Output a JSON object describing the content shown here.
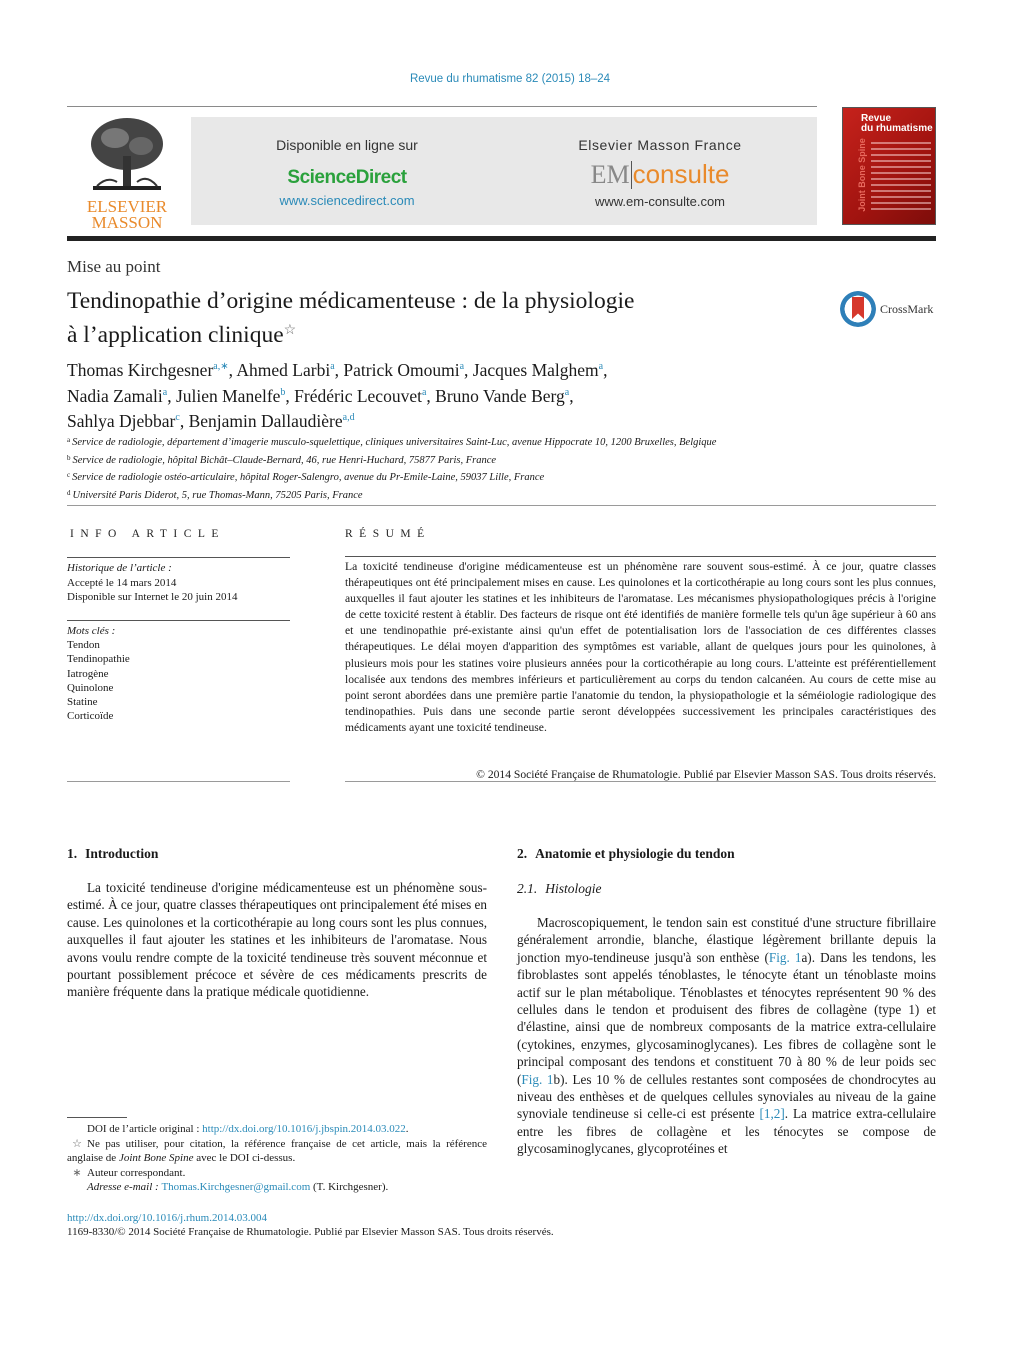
{
  "journal_ref": "Revue du rhumatisme 82 (2015) 18–24",
  "publisher_logo": {
    "icon": "elsevier-tree-logo",
    "line1": "ELSEVIER",
    "line2": "MASSON"
  },
  "banner": {
    "sciencedirect": {
      "caption": "Disponible en ligne sur",
      "name": "ScienceDirect",
      "url": "www.sciencedirect.com"
    },
    "emconsulte": {
      "caption": "Elsevier Masson France",
      "name_em": "EM",
      "name_consulte": "consulte",
      "url": "www.em-consulte.com"
    }
  },
  "cover": {
    "title_line1": "Revue",
    "title_line2": "du rhumatisme",
    "side_text": "Joint Bone Spine"
  },
  "article": {
    "section_type": "Mise au point",
    "title_line1": "Tendinopathie d’origine médicamenteuse : de la physiologie",
    "title_line2": "à l’application clinique",
    "title_mark": "☆",
    "crossmark_label": "CrossMark",
    "authors": [
      {
        "name": "Thomas Kirchgesner",
        "aff": "a,∗",
        "sep": ", "
      },
      {
        "name": "Ahmed Larbi",
        "aff": "a",
        "sep": ", "
      },
      {
        "name": "Patrick Omoumi",
        "aff": "a",
        "sep": ", "
      },
      {
        "name": "Jacques Malghem",
        "aff": "a",
        "sep": ","
      },
      {
        "name": "Nadia Zamali",
        "aff": "a",
        "sep": ", "
      },
      {
        "name": "Julien Manelfe",
        "aff": "b",
        "sep": ", "
      },
      {
        "name": "Frédéric Lecouvet",
        "aff": "a",
        "sep": ", "
      },
      {
        "name": "Bruno Vande Berg",
        "aff": "a",
        "sep": ","
      },
      {
        "name": "Sahlya Djebbar",
        "aff": "c",
        "sep": ", "
      },
      {
        "name": "Benjamin Dallaudière",
        "aff": "a,d",
        "sep": ""
      }
    ],
    "affiliations": [
      {
        "key": "a",
        "text": "Service de radiologie, département d’imagerie musculo-squelettique, cliniques universitaires Saint-Luc, avenue Hippocrate 10, 1200 Bruxelles, Belgique"
      },
      {
        "key": "b",
        "text": "Service de radiologie, hôpital Bichât–Claude-Bernard, 46, rue Henri-Huchard, 75877 Paris, France"
      },
      {
        "key": "c",
        "text": "Service de radiologie ostéo-articulaire, hôpital Roger-Salengro, avenue du Pr-Emile-Laine, 59037 Lille, France"
      },
      {
        "key": "d",
        "text": "Université Paris Diderot, 5, rue Thomas-Mann, 75205 Paris, France"
      }
    ]
  },
  "info": {
    "heading": "INFO ARTICLE",
    "history_label": "Historique de l’article :",
    "history": [
      "Accepté le 14 mars 2014",
      "Disponible sur Internet le 20 juin 2014"
    ],
    "keywords_label": "Mots clés :",
    "keywords": [
      "Tendon",
      "Tendinopathie",
      "Iatrogène",
      "Quinolone",
      "Statine",
      "Corticoïde"
    ]
  },
  "resume": {
    "heading": "RÉSUMÉ",
    "text": "La toxicité tendineuse d'origine médicamenteuse est un phénomène rare souvent sous-estimé. À ce jour, quatre classes thérapeutiques ont été principalement mises en cause. Les quinolones et la corticothérapie au long cours sont les plus connues, auxquelles il faut ajouter les statines et les inhibiteurs de l'aromatase. Les mécanismes physiopathologiques précis à l'origine de cette toxicité restent à établir. Des facteurs de risque ont été identifiés de manière formelle tels qu'un âge supérieur à 60 ans et une tendinopathie pré-existante ainsi qu'un effet de potentialisation lors de l'association de ces différentes classes thérapeutiques. Le délai moyen d'apparition des symptômes est variable, allant de quelques jours pour les quinolones, à plusieurs mois pour les statines voire plusieurs années pour la corticothérapie au long cours. L'atteinte est préférentiellement localisée aux tendons des membres inférieurs et particulièrement au corps du tendon calcanéen. Au cours de cette mise au point seront abordées dans une première partie l'anatomie du tendon, la physiopathologie et la séméiologie radiologique des tendinopathies. Puis dans une seconde partie seront développées successivement les principales caractéristiques des médicaments ayant une toxicité tendineuse.",
    "copyright": "© 2014 Société Française de Rhumatologie. Publié par Elsevier Masson SAS. Tous droits réservés."
  },
  "sections": {
    "intro": {
      "number": "1.",
      "title": "Introduction",
      "text": "La toxicité tendineuse d'origine médicamenteuse est un phénomène sous-estimé. À ce jour, quatre classes thérapeutiques ont principalement été mises en cause. Les quinolones et la corticothérapie au long cours sont les plus connues, auxquelles il faut ajouter les statines et les inhibiteurs de l'aromatase. Nous avons voulu rendre compte de la toxicité tendineuse très souvent méconnue et pourtant possiblement précoce et sévère de ces médicaments prescrits de manière fréquente dans la pratique médicale quotidienne."
    },
    "anatomy": {
      "number": "2.",
      "title": "Anatomie et physiologie du tendon",
      "sub_number": "2.1.",
      "sub_title": "Histologie",
      "text_part1": "Macroscopiquement, le tendon sain est constitué d'une structure fibrillaire généralement arrondie, blanche, élastique légèrement brillante depuis la jonction myo-tendineuse jusqu'à son enthèse (",
      "fig1_link": "Fig. 1",
      "text_part2": "a). Dans les tendons, les fibroblastes sont appelés ténoblastes, le ténocyte étant un ténoblaste moins actif sur le plan métabolique. Ténoblastes et ténocytes représentent 90 % des cellules dans le tendon et produisent des fibres de collagène (type 1) et d'élastine, ainsi que de nombreux composants de la matrice extra-cellulaire (cytokines, enzymes, glycosaminoglycanes). Les fibres de collagène sont le principal composant des tendons et constituent 70 à 80 % de leur poids sec (",
      "fig1b_link": "Fig. 1",
      "text_part3": "b). Les 10 % de cellules restantes sont composées de chondrocytes au niveau des enthèses et de quelques cellules synoviales au niveau de la gaine synoviale tendineuse si celle-ci est présente ",
      "ref_link": "[1,2]",
      "text_part4": ". La matrice extra-cellulaire entre les fibres de collagène et les ténocytes se compose de glycosaminoglycanes, glycoprotéines et"
    }
  },
  "footnotes": {
    "doi_label": "DOI de l’article original : ",
    "doi_url": "http://dx.doi.org/10.1016/j.jbspin.2014.03.022",
    "doi_end": ".",
    "star_mark": "☆",
    "star_text_1": "Ne pas utiliser, pour citation, la référence française de cet article, mais la référence anglaise de ",
    "star_journal": "Joint Bone Spine",
    "star_text_2": " avec le DOI ci-dessus.",
    "author_mark": "∗",
    "author_text": "Auteur correspondant.",
    "email_label": "Adresse e-mail : ",
    "email": "Thomas.Kirchgesner@gmail.com",
    "email_suffix": " (T. Kirchgesner)."
  },
  "bottom": {
    "doi_url": "http://dx.doi.org/10.1016/j.rhum.2014.03.004",
    "issn_line": "1169-8330/© 2014 Société Française de Rhumatologie. Publié par Elsevier Masson SAS. Tous droits réservés."
  }
}
